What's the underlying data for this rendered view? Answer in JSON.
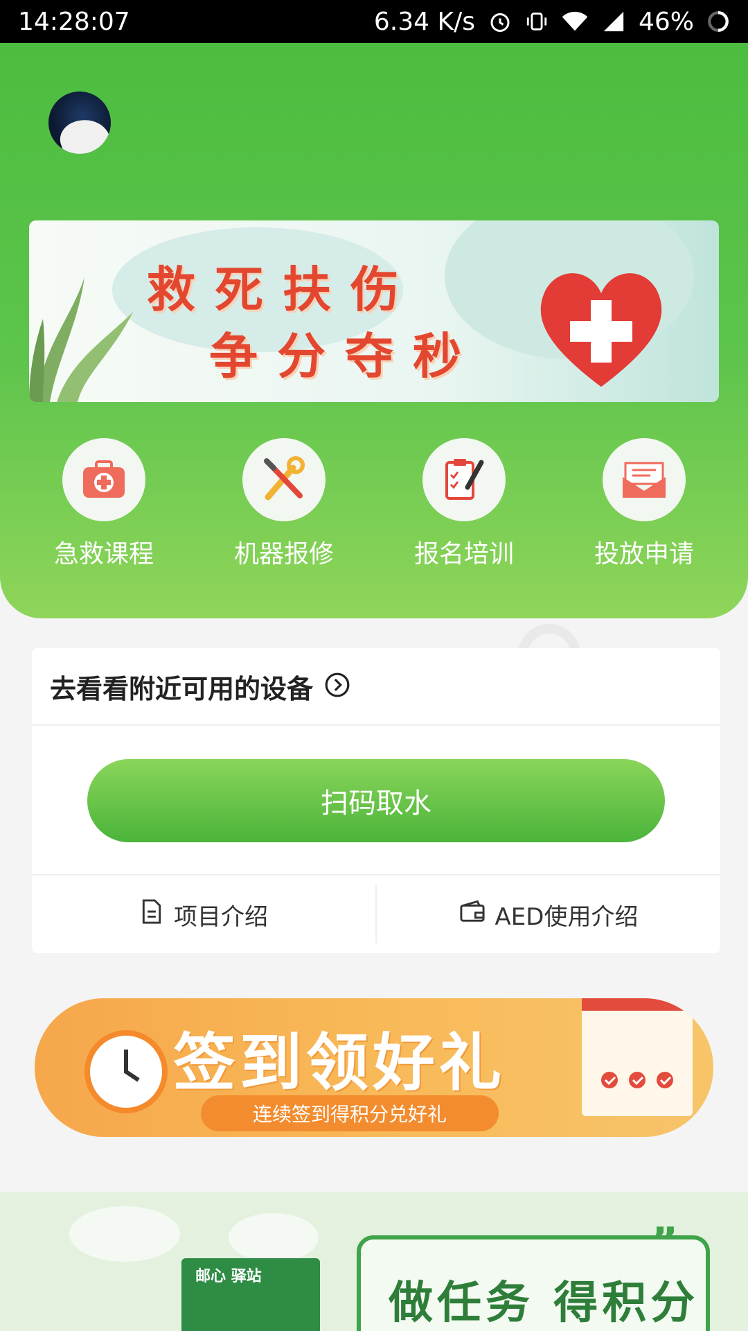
{
  "status_bar": {
    "time": "14:28:07",
    "net_speed": "6.34 K/s",
    "battery": "46%"
  },
  "hero_banner": {
    "line1": "救死扶伤",
    "line2": "争分夺秒"
  },
  "menu": [
    {
      "label": "急救课程",
      "icon": "first-aid-kit-icon"
    },
    {
      "label": "机器报修",
      "icon": "repair-tools-icon"
    },
    {
      "label": "报名培训",
      "icon": "clipboard-pen-icon"
    },
    {
      "label": "投放申请",
      "icon": "envelope-icon"
    }
  ],
  "device_card": {
    "title": "去看看附近可用的设备",
    "scan_button": "扫码取水",
    "links": [
      {
        "label": "项目介绍",
        "icon": "document-icon"
      },
      {
        "label": "AED使用介绍",
        "icon": "wallet-icon"
      }
    ]
  },
  "sign_banner": {
    "title": "签到领好礼",
    "subtitle": "连续签到得积分兑好礼"
  },
  "bottom_banner": {
    "kiosk_label": "邮心 驿站",
    "task_text": "做任务 得积分"
  },
  "colors": {
    "primary_green": "#4cbd3f",
    "accent_orange": "#f6a74b",
    "banner_red": "#e3472f"
  }
}
